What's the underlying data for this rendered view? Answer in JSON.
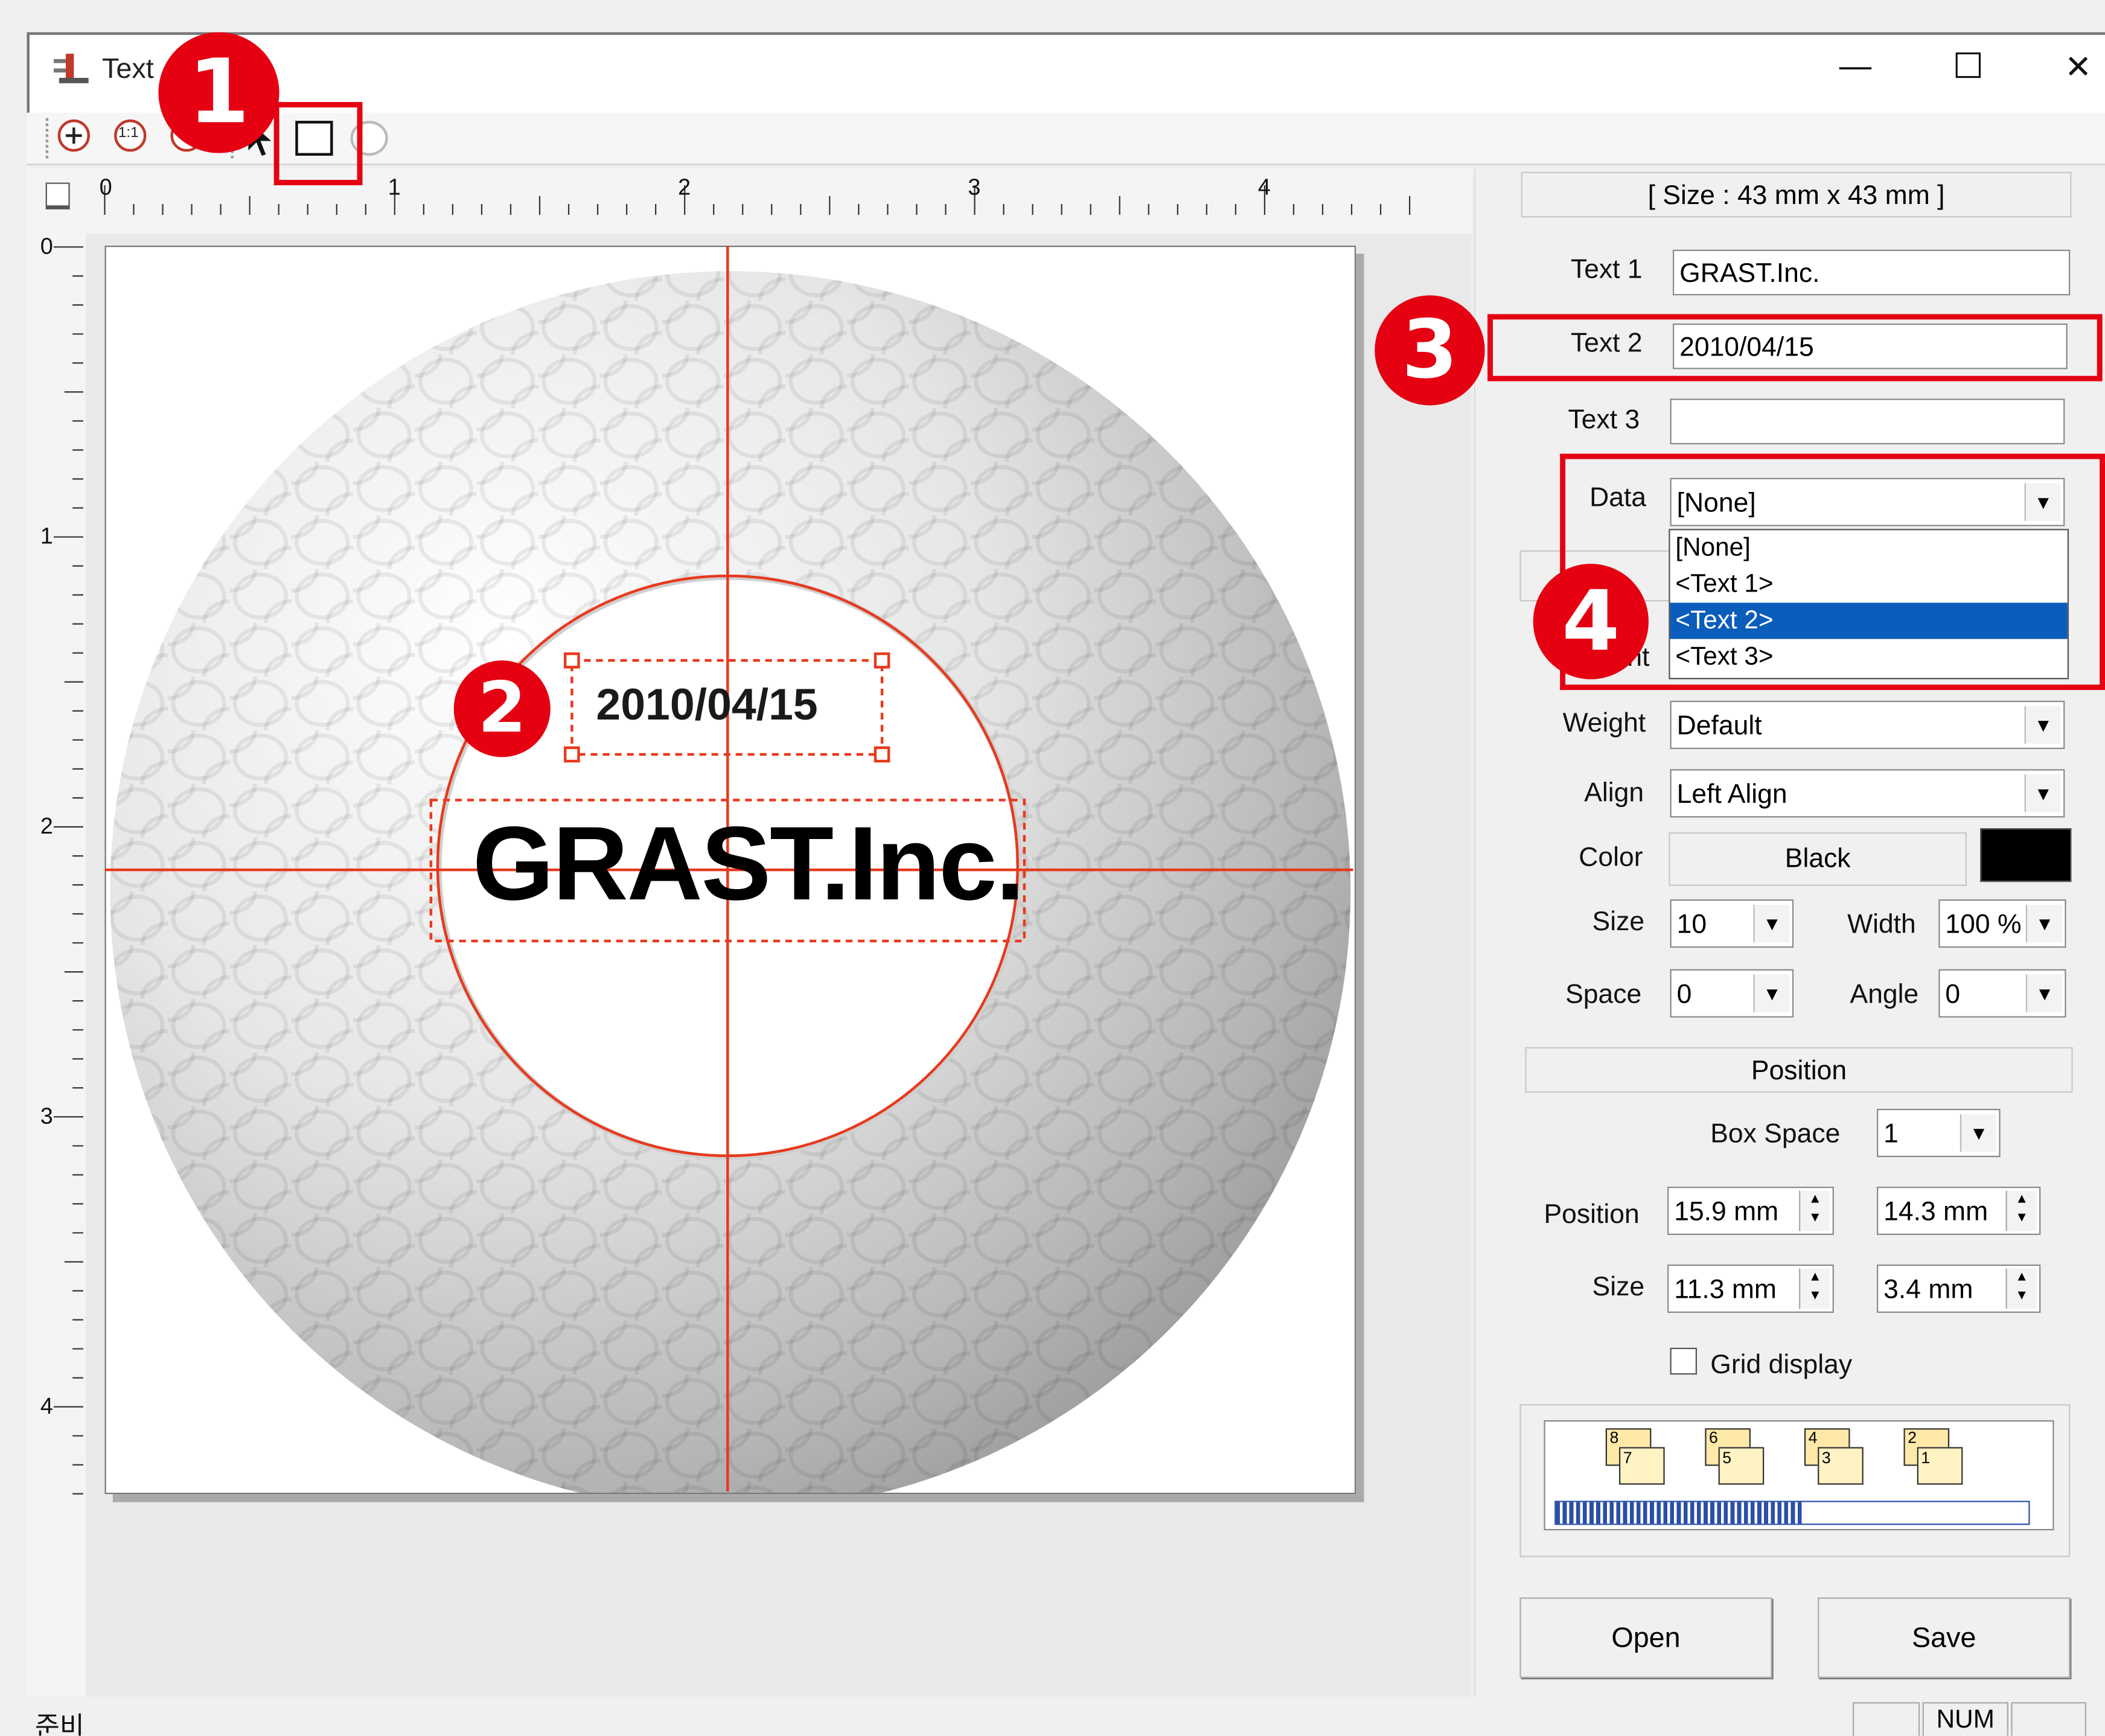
{
  "window": {
    "title": "Text",
    "min_glyph": "—",
    "max_glyph": "☐",
    "close_glyph": "✕"
  },
  "toolbar": {
    "zoom_in_icon": "zoom-in-icon",
    "actual_size_label": "1:1",
    "zoom_out_icon": "zoom-out-icon"
  },
  "ruler": {
    "h_ticks": [
      "0",
      "1",
      "2",
      "3",
      "4"
    ],
    "v_ticks": [
      "0",
      "1",
      "2",
      "3",
      "4"
    ]
  },
  "canvas": {
    "text_date": "2010/04/15",
    "text_company": "GRAST.Inc.",
    "guide_color": "#e8391d"
  },
  "panel": {
    "size_header": "[ Size : 43 mm x 43 mm ]",
    "text1_label": "Text 1",
    "text1_value": "GRAST.Inc.",
    "text2_label": "Text 2",
    "text2_value": "2010/04/15",
    "text3_label": "Text 3",
    "text3_value": "",
    "data_label": "Data",
    "data_value": "[None]",
    "data_options": [
      "[None]",
      "<Text 1>",
      "<Text 2>",
      "<Text 3>"
    ],
    "data_selected_option": "<Text 2>",
    "font_label_partial": "nt",
    "weight_label": "Weight",
    "weight_value": "Default",
    "align_label": "Align",
    "align_value": "Left Align",
    "color_label": "Color",
    "color_value": "Black",
    "color_swatch": "#000000",
    "size_label": "Size",
    "size_value": "10",
    "width_label": "Width",
    "width_value": "100 %",
    "space_label": "Space",
    "space_value": "0",
    "angle_label": "Angle",
    "angle_value": "0",
    "position_header": "Position",
    "box_space_label": "Box Space",
    "box_space_value": "1",
    "position_label": "Position",
    "position_x": "15.9 mm",
    "position_y": "14.3 mm",
    "size2_label": "Size",
    "size_w": "11.3 mm",
    "size_h": "3.4 mm",
    "grid_display_label": "Grid display",
    "grid_display_checked": false,
    "layers": [
      "8",
      "7",
      "6",
      "5",
      "4",
      "3",
      "2",
      "1"
    ],
    "open_button": "Open",
    "save_button": "Save"
  },
  "status": {
    "ready_text": "준비",
    "num_indicator": "NUM"
  },
  "annotations": {
    "badge1": "1",
    "badge2": "2",
    "badge3": "3",
    "badge4": "4",
    "accent_color": "#e50012"
  }
}
